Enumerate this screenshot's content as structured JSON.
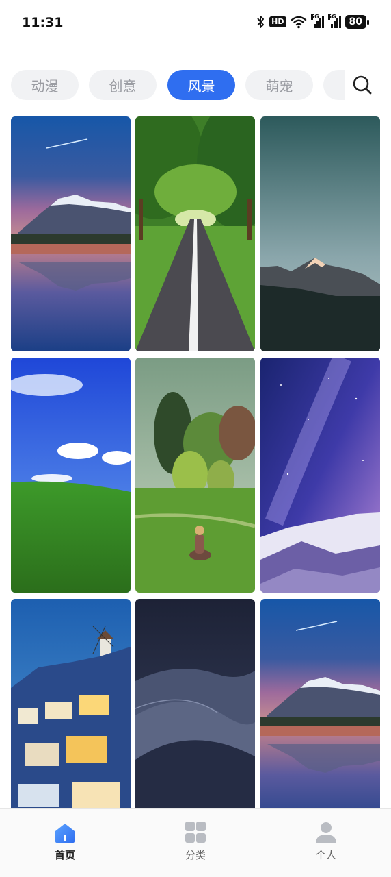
{
  "status_bar": {
    "time": "11:31",
    "hd_badge": "HD",
    "net_left": "5G",
    "net_right": "5G",
    "battery": "80"
  },
  "tabs": [
    {
      "label": "动漫",
      "active": false
    },
    {
      "label": "创意",
      "active": false
    },
    {
      "label": "风景",
      "active": true
    },
    {
      "label": "萌宠",
      "active": false
    }
  ],
  "wallpapers": [
    {
      "subject": "snowy mountain at sunset with lake reflection"
    },
    {
      "subject": "tree-lined country road"
    },
    {
      "subject": "mountain peaks under misty teal sky"
    },
    {
      "subject": "green hill under blue sky"
    },
    {
      "subject": "woman sitting in a meadow by trees"
    },
    {
      "subject": "milky way over snowy mountain"
    },
    {
      "subject": "Santorini village at dusk with windmill"
    },
    {
      "subject": "desert dunes at night"
    },
    {
      "subject": "snowy mountain at sunset with lake reflection"
    }
  ],
  "bottom_nav": [
    {
      "label": "首页",
      "icon": "home-icon",
      "active": true
    },
    {
      "label": "分类",
      "icon": "category-grid-icon",
      "active": false
    },
    {
      "label": "个人",
      "icon": "person-icon",
      "active": false
    }
  ],
  "colors": {
    "accent": "#2f6ef0",
    "tab_bg": "#f1f2f4",
    "tab_text": "#9a9ca2"
  }
}
